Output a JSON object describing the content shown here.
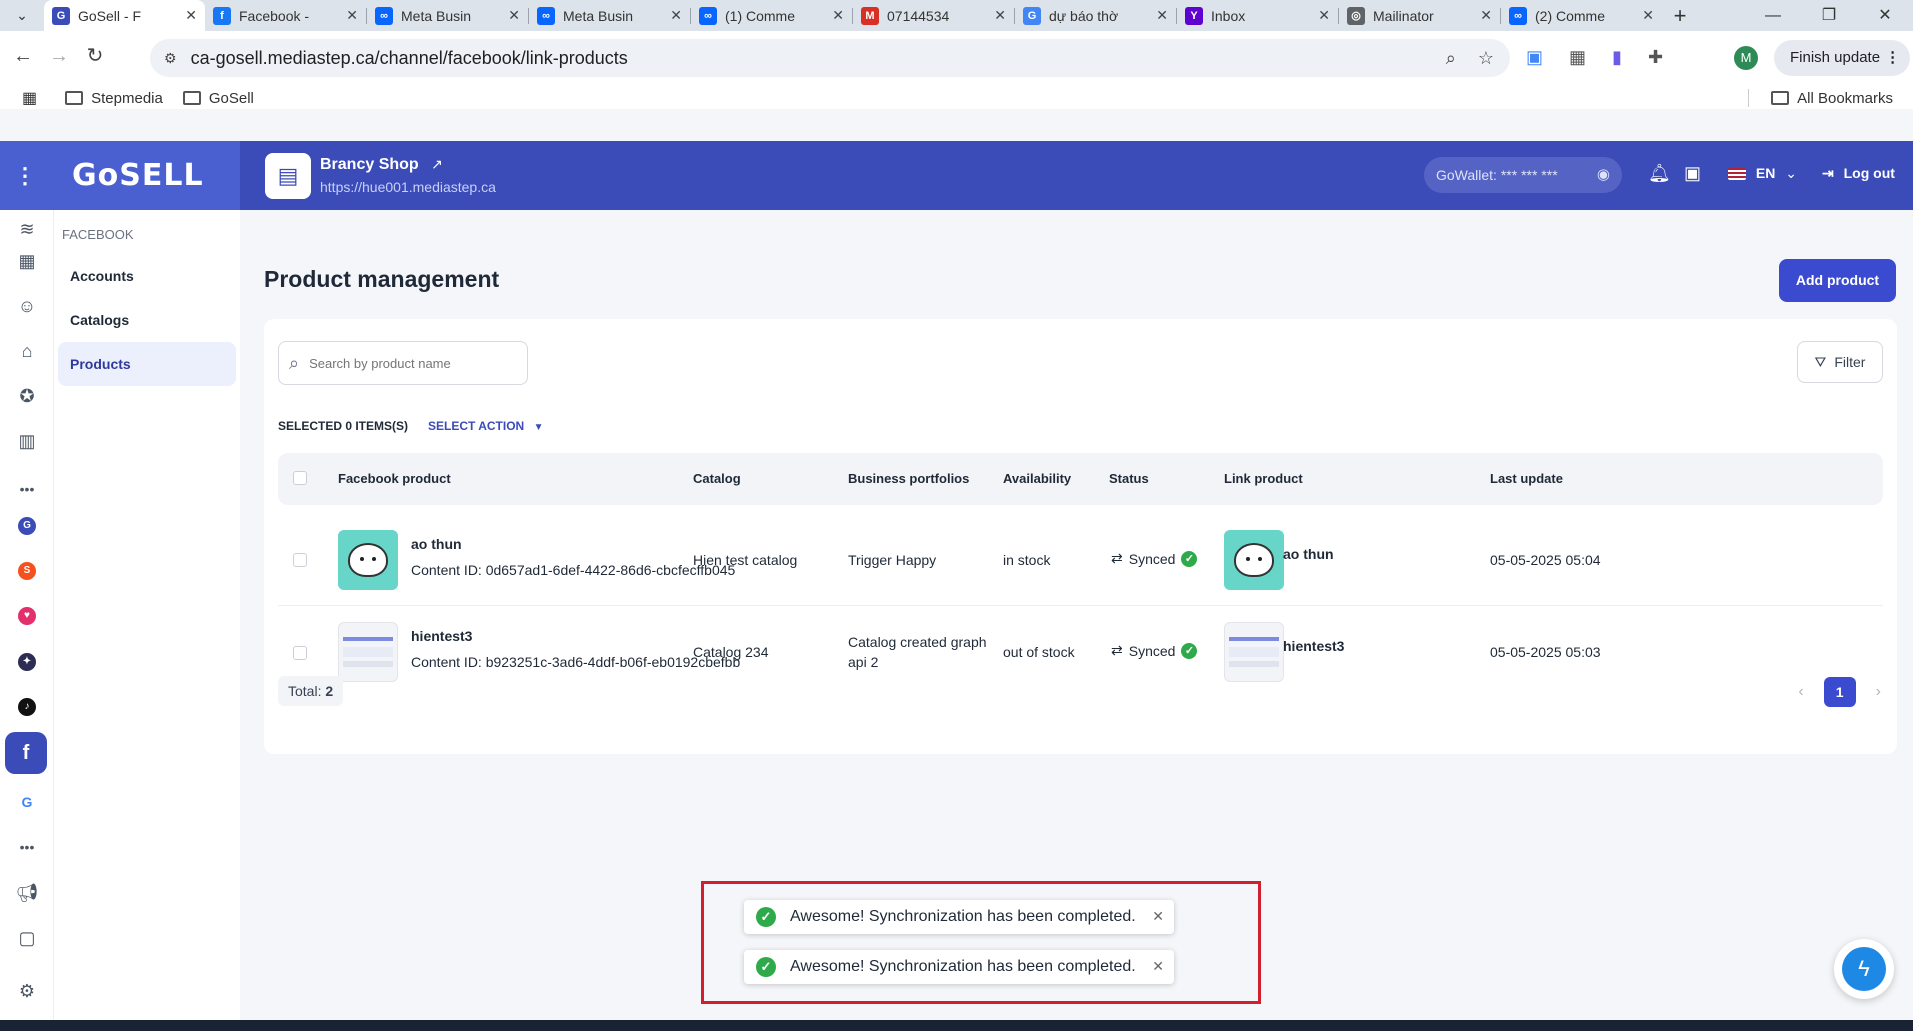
{
  "browser": {
    "tabs": [
      {
        "label": "GoSell - F",
        "icon": "gosell-icon",
        "color": "#3b4bb8",
        "glyph": "G",
        "active": true
      },
      {
        "label": "Facebook -",
        "icon": "facebook-icon",
        "color": "#1877f2",
        "glyph": "f"
      },
      {
        "label": "Meta Busin",
        "icon": "meta-icon",
        "color": "#0866ff",
        "glyph": "∞"
      },
      {
        "label": "Meta Busin",
        "icon": "meta-icon",
        "color": "#0866ff",
        "glyph": "∞"
      },
      {
        "label": "(1) Comme",
        "icon": "meta-icon",
        "color": "#0866ff",
        "glyph": "∞"
      },
      {
        "label": "07144534",
        "icon": "gmail-icon",
        "color": "#d93025",
        "glyph": "M"
      },
      {
        "label": "dự báo thờ",
        "icon": "google-icon",
        "color": "#4285f4",
        "glyph": "G"
      },
      {
        "label": "Inbox",
        "icon": "yahoo-icon",
        "color": "#5f01d1",
        "glyph": "Y"
      },
      {
        "label": "Mailinator",
        "icon": "globe-icon",
        "color": "#5f6368",
        "glyph": "◎"
      },
      {
        "label": "(2) Comme",
        "icon": "meta-icon",
        "color": "#0866ff",
        "glyph": "∞"
      }
    ],
    "url": "ca-gosell.mediastep.ca/channel/facebook/link-products",
    "profile_initial": "M",
    "finish_update": "Finish update",
    "bookmarks": [
      "Stepmedia",
      "GoSell"
    ],
    "all_bookmarks": "All Bookmarks"
  },
  "header": {
    "logo": "GoSELL",
    "shop_name": "Brancy Shop",
    "shop_url": "https://hue001.mediastep.ca",
    "wallet": "GoWallet: *** *** ***",
    "language": "EN",
    "logout": "Log out"
  },
  "subnav": {
    "section": "FACEBOOK",
    "items": [
      "Accounts",
      "Catalogs",
      "Products"
    ],
    "active": "Products"
  },
  "main": {
    "title": "Product management",
    "add_button": "Add product",
    "search_placeholder": "Search by product name",
    "filter": "Filter",
    "selected_info": "SELECTED 0 ITEMS(S)",
    "select_action": "SELECT ACTION",
    "columns": [
      "Facebook product",
      "Catalog",
      "Business portfolios",
      "Availability",
      "Status",
      "Link product",
      "Last update"
    ],
    "rows": [
      {
        "name": "ao thun",
        "content_id": "Content ID: 0d657ad1-6def-4422-86d6-cbcfecffb045",
        "catalog": "Hien test catalog",
        "portfolio": "Trigger Happy",
        "availability": "in stock",
        "status": "Synced",
        "link_product": "ao thun",
        "last_update": "05-05-2025 05:04"
      },
      {
        "name": "hientest3",
        "content_id": "Content ID: b923251c-3ad6-4ddf-b06f-eb0192cbefbb",
        "catalog": "Catalog 234",
        "portfolio_line1": "Catalog created graph",
        "portfolio_line2": "api 2",
        "availability": "out of stock",
        "status": "Synced",
        "link_product": "hientest3",
        "last_update": "05-05-2025 05:03"
      }
    ],
    "total_label": "Total:",
    "total_value": "2",
    "current_page": "1"
  },
  "toasts": [
    "Awesome! Synchronization has been completed.",
    "Awesome! Synchronization has been completed."
  ],
  "colors": {
    "brand": "#3b4bb8",
    "success": "#2faa4b",
    "highlight_frame": "#d11f2f"
  }
}
